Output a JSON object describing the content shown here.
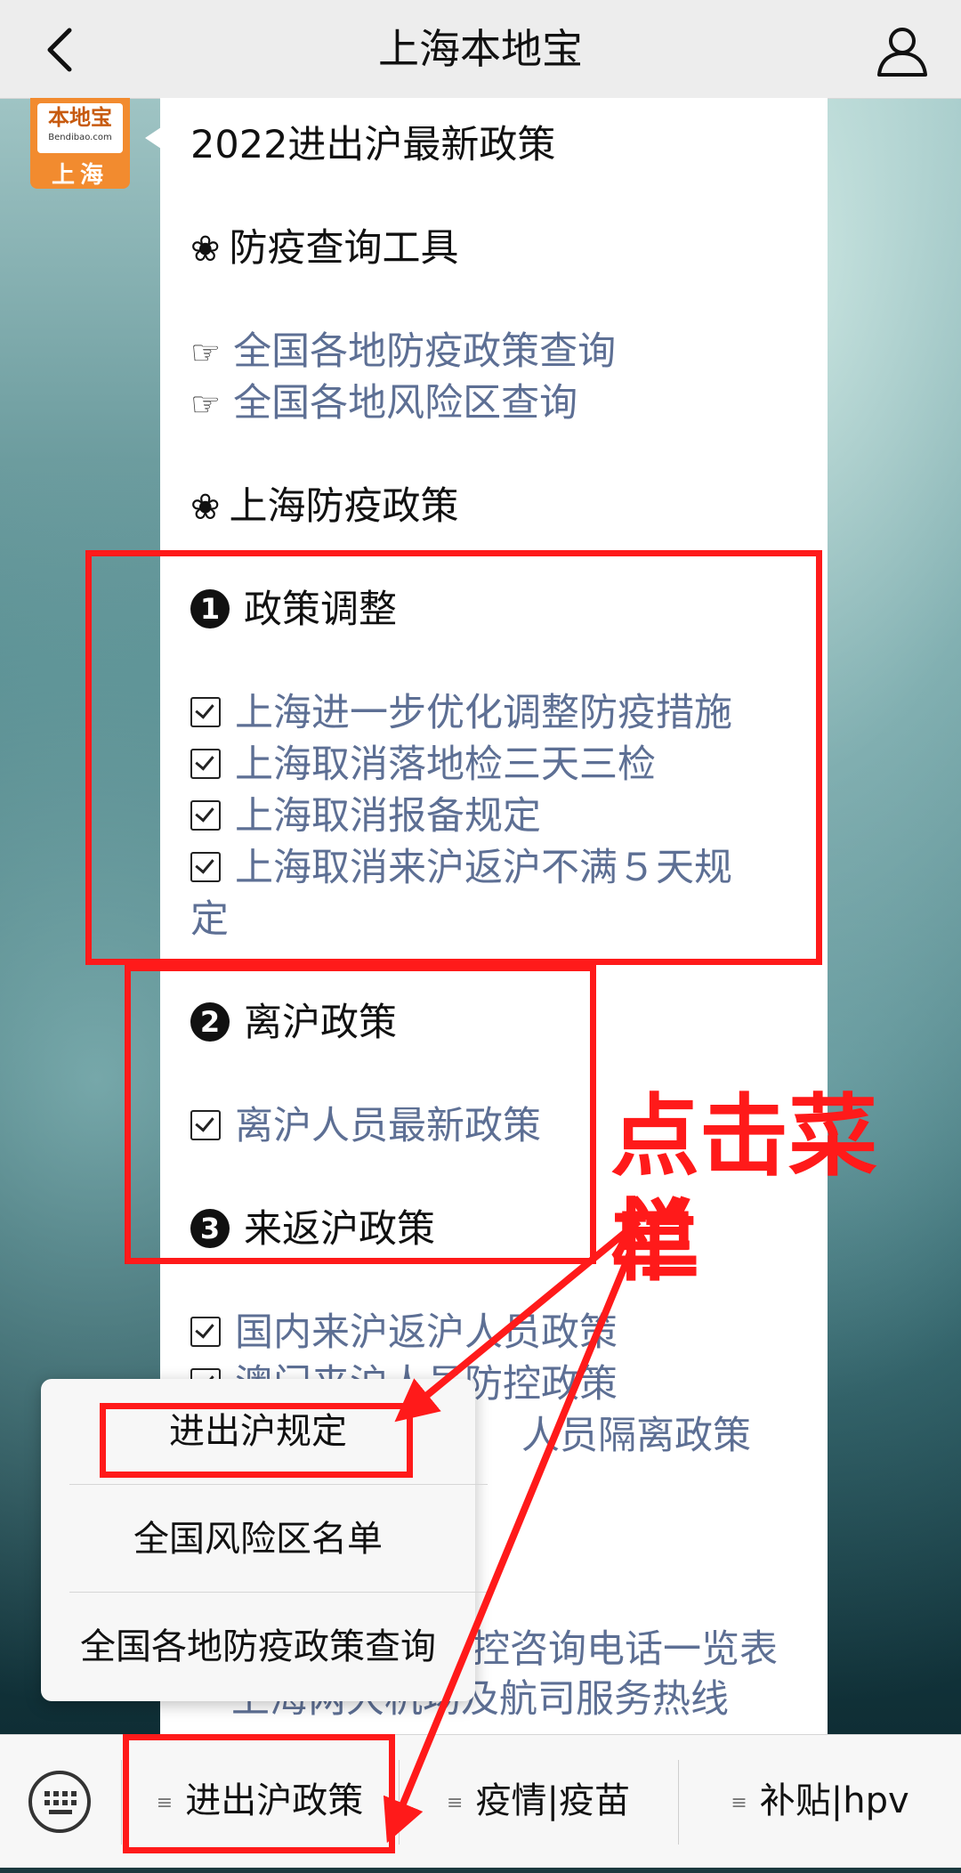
{
  "header": {
    "title": "上海本地宝",
    "back_icon": "back-arrow-icon",
    "profile_icon": "user-icon"
  },
  "avatar": {
    "brand": "本地宝",
    "url": "Bendibao.com",
    "city": "上海"
  },
  "message": {
    "title": "2022进出沪最新政策",
    "section_tools": "防疫查询工具",
    "section_icon": "❀",
    "hand_icon": "☞",
    "tool_links": [
      "全国各地防疫政策查询",
      "全国各地风险区查询"
    ],
    "section_sh": "上海防疫政策",
    "groups": [
      {
        "num": "1",
        "title": "政策调整",
        "items": [
          "上海进一步优化调整防疫措施",
          "上海取消落地检三天三检",
          "上海取消报备规定",
          "上海取消来沪返沪不满５天规",
          "定"
        ]
      },
      {
        "num": "2",
        "title": "离沪政策",
        "items": [
          "离沪人员最新政策"
        ]
      },
      {
        "num": "3",
        "title": "来返沪政策",
        "items": [
          "国内来沪返沪人员政策",
          "澳门来沪人员防控政策",
          "人员隔离政策"
        ]
      }
    ],
    "lower_items": [
      "控咨询电话一览表",
      "上海两大机场及航司服务热线"
    ]
  },
  "annotation": {
    "text_line1": "点击菜单",
    "text_line2": "栏",
    "color": "#ff1a1a"
  },
  "popup_menu": {
    "items": [
      "进出沪规定",
      "全国风险区名单",
      "全国各地防疫政策查询"
    ]
  },
  "bottom_menu": {
    "keyboard_icon": "keyboard-icon",
    "tabs": [
      "进出沪政策",
      "疫情|疫苗",
      "补贴|hpv"
    ]
  }
}
